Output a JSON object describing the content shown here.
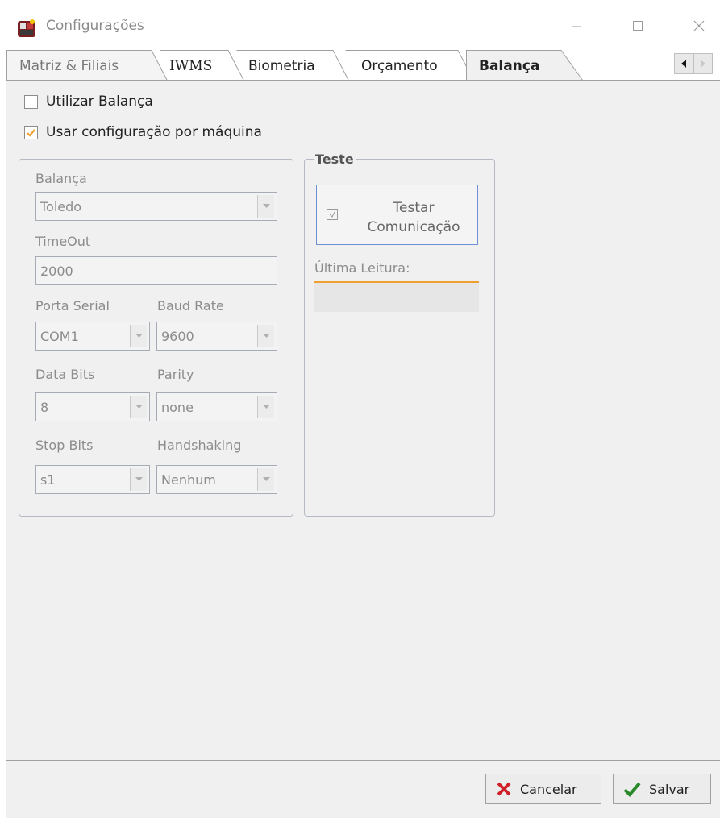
{
  "window": {
    "title": "Configurações",
    "controls": {
      "minimize": "—",
      "maximize": "☐",
      "close": "✕"
    }
  },
  "tabs": [
    {
      "label": "Matriz & Filiais",
      "selected": false
    },
    {
      "label": "IWMS",
      "selected": false
    },
    {
      "label": "Biometria",
      "selected": false
    },
    {
      "label": "Orçamento",
      "selected": false
    },
    {
      "label": "Balança",
      "selected": true
    }
  ],
  "tab_scroll": {
    "left_icon": "arrow-left-icon",
    "right_icon": "arrow-right-icon"
  },
  "options": {
    "utilizar_balanca": {
      "label": "Utilizar Balança",
      "checked": false
    },
    "usar_config_maquina": {
      "label": "Usar configuração por máquina",
      "checked": true
    }
  },
  "settings": {
    "balanca": {
      "label": "Balança",
      "value": "Toledo"
    },
    "timeout": {
      "label": "TimeOut",
      "value": "2000"
    },
    "porta_serial": {
      "label": "Porta Serial",
      "value": "COM1"
    },
    "baud_rate": {
      "label": "Baud Rate",
      "value": "9600"
    },
    "data_bits": {
      "label": "Data Bits",
      "value": "8"
    },
    "parity": {
      "label": "Parity",
      "value": "none"
    },
    "stop_bits": {
      "label": "Stop Bits",
      "value": "s1"
    },
    "handshaking": {
      "label": "Handshaking",
      "value": "Nenhum"
    }
  },
  "teste": {
    "legend": "Teste",
    "button_line1": "Testar",
    "button_line2": "Comunicação",
    "ultima_leitura_label": "Última Leitura:",
    "ultima_leitura_value": ""
  },
  "footer": {
    "cancel_label": "Cancelar",
    "save_label": "Salvar"
  },
  "colors": {
    "accent_orange": "#f0a030",
    "cancel_red": "#d0202a",
    "save_green": "#2a8a2a",
    "focus_blue": "#6e8fd6"
  }
}
